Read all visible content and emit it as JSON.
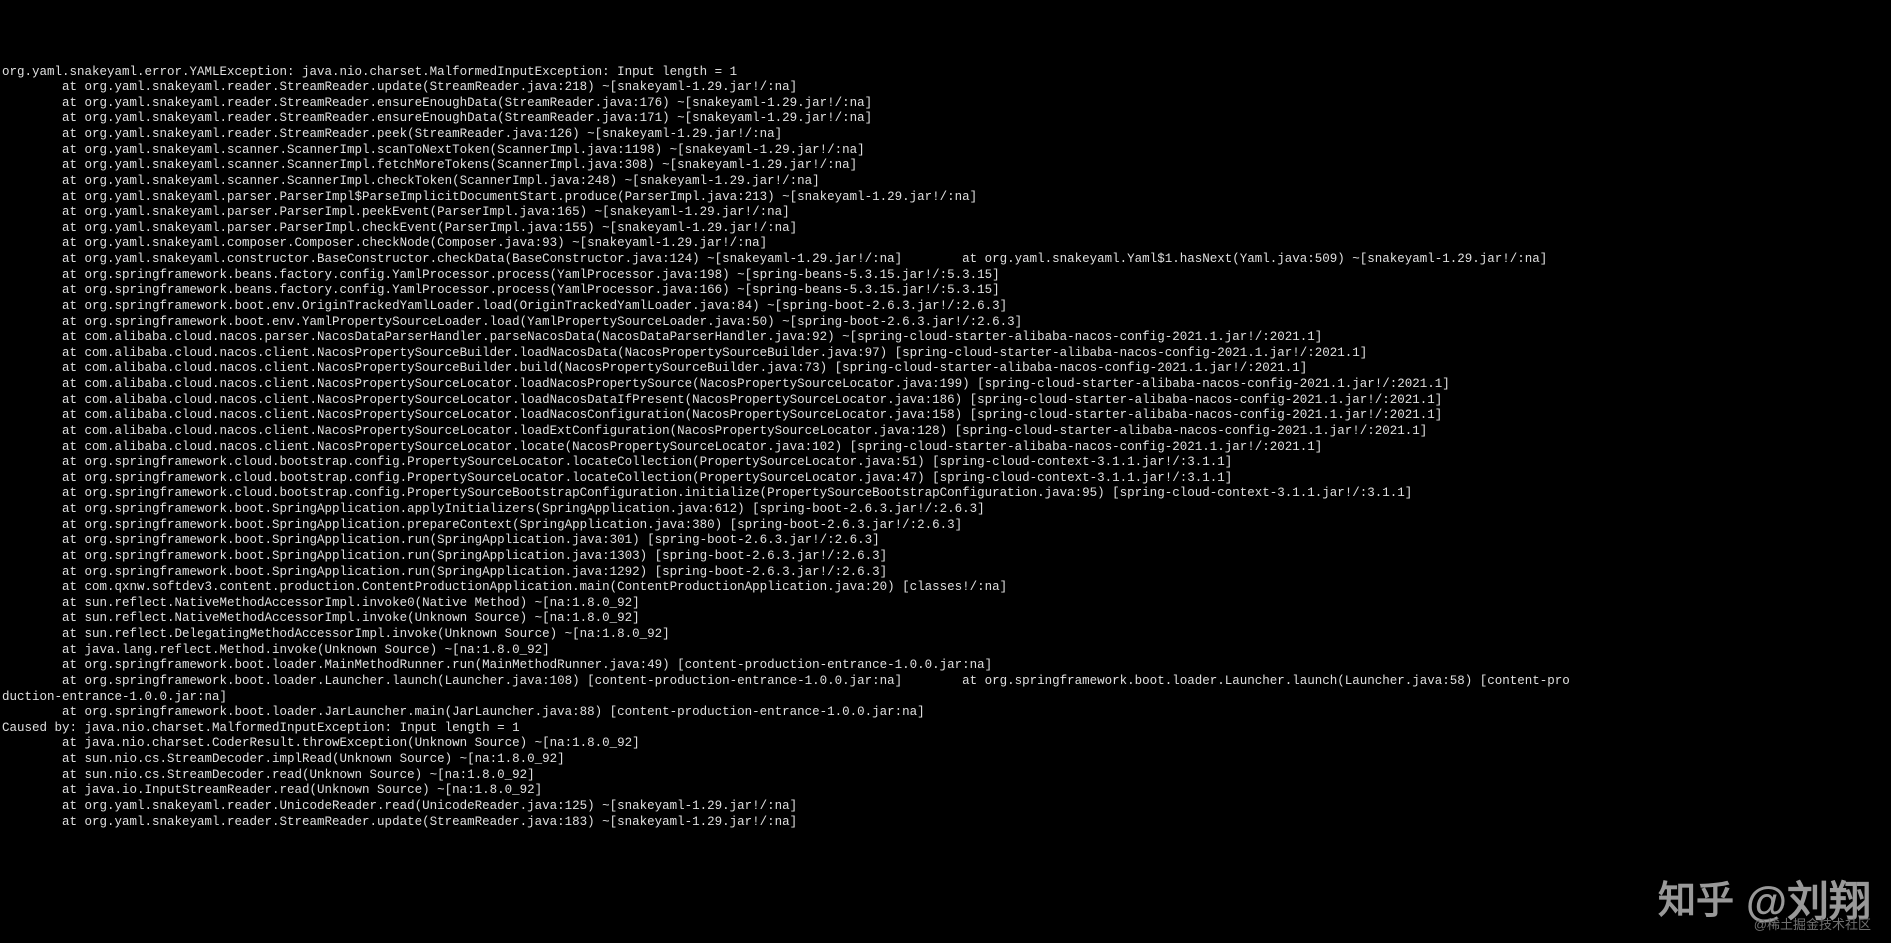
{
  "stacktrace": {
    "lines": [
      "org.yaml.snakeyaml.error.YAMLException: java.nio.charset.MalformedInputException: Input length = 1",
      "        at org.yaml.snakeyaml.reader.StreamReader.update(StreamReader.java:218) ~[snakeyaml-1.29.jar!/:na]",
      "        at org.yaml.snakeyaml.reader.StreamReader.ensureEnoughData(StreamReader.java:176) ~[snakeyaml-1.29.jar!/:na]",
      "        at org.yaml.snakeyaml.reader.StreamReader.ensureEnoughData(StreamReader.java:171) ~[snakeyaml-1.29.jar!/:na]",
      "        at org.yaml.snakeyaml.reader.StreamReader.peek(StreamReader.java:126) ~[snakeyaml-1.29.jar!/:na]",
      "        at org.yaml.snakeyaml.scanner.ScannerImpl.scanToNextToken(ScannerImpl.java:1198) ~[snakeyaml-1.29.jar!/:na]",
      "        at org.yaml.snakeyaml.scanner.ScannerImpl.fetchMoreTokens(ScannerImpl.java:308) ~[snakeyaml-1.29.jar!/:na]",
      "        at org.yaml.snakeyaml.scanner.ScannerImpl.checkToken(ScannerImpl.java:248) ~[snakeyaml-1.29.jar!/:na]",
      "        at org.yaml.snakeyaml.parser.ParserImpl$ParseImplicitDocumentStart.produce(ParserImpl.java:213) ~[snakeyaml-1.29.jar!/:na]",
      "        at org.yaml.snakeyaml.parser.ParserImpl.peekEvent(ParserImpl.java:165) ~[snakeyaml-1.29.jar!/:na]",
      "        at org.yaml.snakeyaml.parser.ParserImpl.checkEvent(ParserImpl.java:155) ~[snakeyaml-1.29.jar!/:na]",
      "        at org.yaml.snakeyaml.composer.Composer.checkNode(Composer.java:93) ~[snakeyaml-1.29.jar!/:na]",
      "        at org.yaml.snakeyaml.constructor.BaseConstructor.checkData(BaseConstructor.java:124) ~[snakeyaml-1.29.jar!/:na]        at org.yaml.snakeyaml.Yaml$1.hasNext(Yaml.java:509) ~[snakeyaml-1.29.jar!/:na]",
      "        at org.springframework.beans.factory.config.YamlProcessor.process(YamlProcessor.java:198) ~[spring-beans-5.3.15.jar!/:5.3.15]",
      "        at org.springframework.beans.factory.config.YamlProcessor.process(YamlProcessor.java:166) ~[spring-beans-5.3.15.jar!/:5.3.15]",
      "        at org.springframework.boot.env.OriginTrackedYamlLoader.load(OriginTrackedYamlLoader.java:84) ~[spring-boot-2.6.3.jar!/:2.6.3]",
      "        at org.springframework.boot.env.YamlPropertySourceLoader.load(YamlPropertySourceLoader.java:50) ~[spring-boot-2.6.3.jar!/:2.6.3]",
      "        at com.alibaba.cloud.nacos.parser.NacosDataParserHandler.parseNacosData(NacosDataParserHandler.java:92) ~[spring-cloud-starter-alibaba-nacos-config-2021.1.jar!/:2021.1]",
      "        at com.alibaba.cloud.nacos.client.NacosPropertySourceBuilder.loadNacosData(NacosPropertySourceBuilder.java:97) [spring-cloud-starter-alibaba-nacos-config-2021.1.jar!/:2021.1]",
      "        at com.alibaba.cloud.nacos.client.NacosPropertySourceBuilder.build(NacosPropertySourceBuilder.java:73) [spring-cloud-starter-alibaba-nacos-config-2021.1.jar!/:2021.1]",
      "        at com.alibaba.cloud.nacos.client.NacosPropertySourceLocator.loadNacosPropertySource(NacosPropertySourceLocator.java:199) [spring-cloud-starter-alibaba-nacos-config-2021.1.jar!/:2021.1]",
      "        at com.alibaba.cloud.nacos.client.NacosPropertySourceLocator.loadNacosDataIfPresent(NacosPropertySourceLocator.java:186) [spring-cloud-starter-alibaba-nacos-config-2021.1.jar!/:2021.1]",
      "        at com.alibaba.cloud.nacos.client.NacosPropertySourceLocator.loadNacosConfiguration(NacosPropertySourceLocator.java:158) [spring-cloud-starter-alibaba-nacos-config-2021.1.jar!/:2021.1]",
      "        at com.alibaba.cloud.nacos.client.NacosPropertySourceLocator.loadExtConfiguration(NacosPropertySourceLocator.java:128) [spring-cloud-starter-alibaba-nacos-config-2021.1.jar!/:2021.1]",
      "        at com.alibaba.cloud.nacos.client.NacosPropertySourceLocator.locate(NacosPropertySourceLocator.java:102) [spring-cloud-starter-alibaba-nacos-config-2021.1.jar!/:2021.1]",
      "        at org.springframework.cloud.bootstrap.config.PropertySourceLocator.locateCollection(PropertySourceLocator.java:51) [spring-cloud-context-3.1.1.jar!/:3.1.1]",
      "        at org.springframework.cloud.bootstrap.config.PropertySourceLocator.locateCollection(PropertySourceLocator.java:47) [spring-cloud-context-3.1.1.jar!/:3.1.1]",
      "        at org.springframework.cloud.bootstrap.config.PropertySourceBootstrapConfiguration.initialize(PropertySourceBootstrapConfiguration.java:95) [spring-cloud-context-3.1.1.jar!/:3.1.1]",
      "        at org.springframework.boot.SpringApplication.applyInitializers(SpringApplication.java:612) [spring-boot-2.6.3.jar!/:2.6.3]",
      "        at org.springframework.boot.SpringApplication.prepareContext(SpringApplication.java:380) [spring-boot-2.6.3.jar!/:2.6.3]",
      "        at org.springframework.boot.SpringApplication.run(SpringApplication.java:301) [spring-boot-2.6.3.jar!/:2.6.3]",
      "        at org.springframework.boot.SpringApplication.run(SpringApplication.java:1303) [spring-boot-2.6.3.jar!/:2.6.3]",
      "        at org.springframework.boot.SpringApplication.run(SpringApplication.java:1292) [spring-boot-2.6.3.jar!/:2.6.3]",
      "        at com.qxnw.softdev3.content.production.ContentProductionApplication.main(ContentProductionApplication.java:20) [classes!/:na]",
      "        at sun.reflect.NativeMethodAccessorImpl.invoke0(Native Method) ~[na:1.8.0_92]",
      "        at sun.reflect.NativeMethodAccessorImpl.invoke(Unknown Source) ~[na:1.8.0_92]",
      "        at sun.reflect.DelegatingMethodAccessorImpl.invoke(Unknown Source) ~[na:1.8.0_92]",
      "        at java.lang.reflect.Method.invoke(Unknown Source) ~[na:1.8.0_92]",
      "        at org.springframework.boot.loader.MainMethodRunner.run(MainMethodRunner.java:49) [content-production-entrance-1.0.0.jar:na]",
      "        at org.springframework.boot.loader.Launcher.launch(Launcher.java:108) [content-production-entrance-1.0.0.jar:na]        at org.springframework.boot.loader.Launcher.launch(Launcher.java:58) [content-pro",
      "duction-entrance-1.0.0.jar:na]",
      "        at org.springframework.boot.loader.JarLauncher.main(JarLauncher.java:88) [content-production-entrance-1.0.0.jar:na]",
      "Caused by: java.nio.charset.MalformedInputException: Input length = 1",
      "        at java.nio.charset.CoderResult.throwException(Unknown Source) ~[na:1.8.0_92]",
      "        at sun.nio.cs.StreamDecoder.implRead(Unknown Source) ~[na:1.8.0_92]",
      "        at sun.nio.cs.StreamDecoder.read(Unknown Source) ~[na:1.8.0_92]",
      "        at java.io.InputStreamReader.read(Unknown Source) ~[na:1.8.0_92]",
      "        at org.yaml.snakeyaml.reader.UnicodeReader.read(UnicodeReader.java:125) ~[snakeyaml-1.29.jar!/:na]",
      "        at org.yaml.snakeyaml.reader.StreamReader.update(StreamReader.java:183) ~[snakeyaml-1.29.jar!/:na]"
    ]
  },
  "watermark": {
    "zhihu": "知乎",
    "author": "@刘翔",
    "sub": "@稀土掘金技术社区"
  }
}
